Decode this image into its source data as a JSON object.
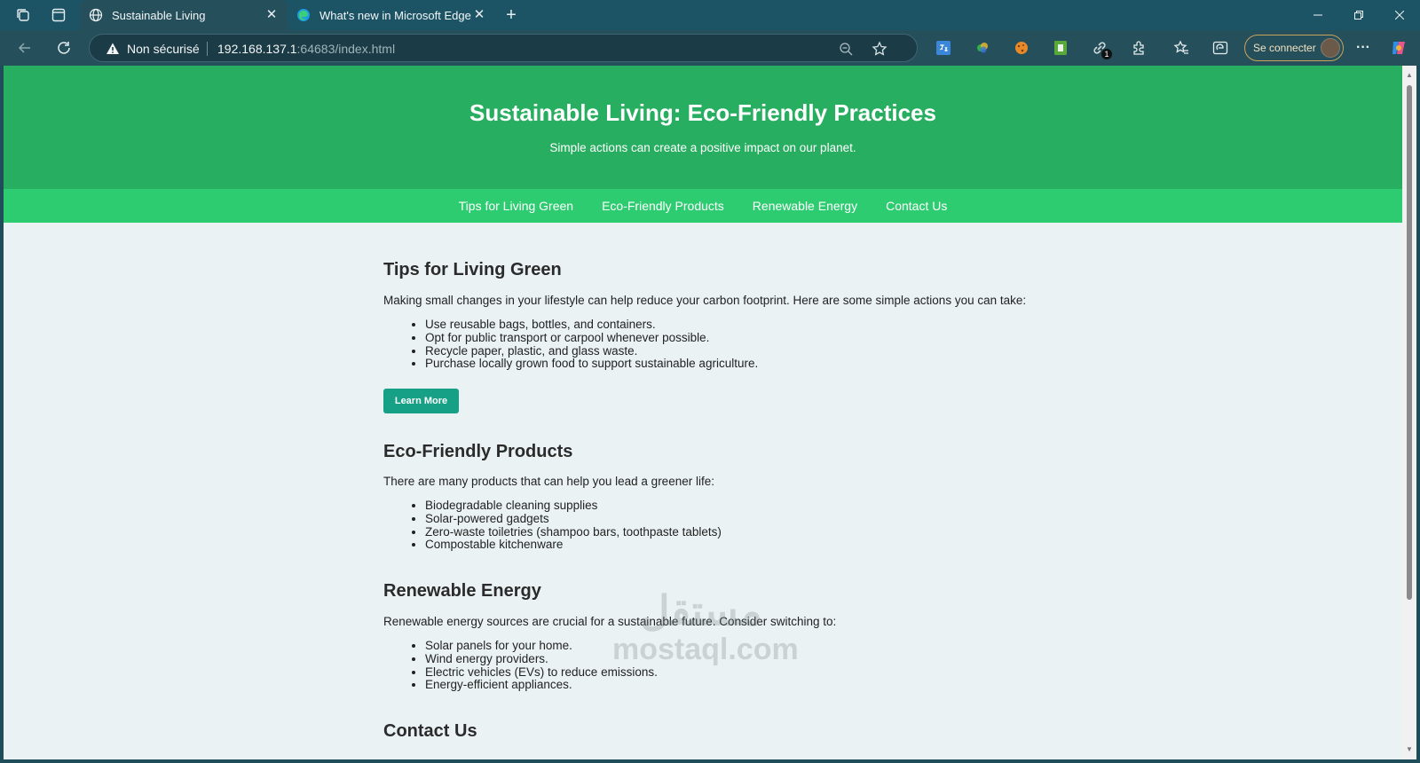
{
  "browser": {
    "tabs": [
      {
        "title": "Sustainable Living",
        "active": true
      },
      {
        "title": "What's new in Microsoft Edge",
        "active": false
      }
    ],
    "address": {
      "security": "Non sécurisé",
      "url_host": "192.168.137.1",
      "url_rest": ":64683/index.html"
    },
    "signin_label": "Se connecter",
    "extension_badge": "1"
  },
  "site": {
    "title": "Sustainable Living: Eco-Friendly Practices",
    "subtitle": "Simple actions can create a positive impact on our planet.",
    "nav": [
      "Tips for Living Green",
      "Eco-Friendly Products",
      "Renewable Energy",
      "Contact Us"
    ],
    "sections": {
      "tips": {
        "heading": "Tips for Living Green",
        "intro": "Making small changes in your lifestyle can help reduce your carbon footprint. Here are some simple actions you can take:",
        "items": [
          "Use reusable bags, bottles, and containers.",
          "Opt for public transport or carpool whenever possible.",
          "Recycle paper, plastic, and glass waste.",
          "Purchase locally grown food to support sustainable agriculture."
        ],
        "button": "Learn More"
      },
      "products": {
        "heading": "Eco-Friendly Products",
        "intro": "There are many products that can help you lead a greener life:",
        "items": [
          "Biodegradable cleaning supplies",
          "Solar-powered gadgets",
          "Zero-waste toiletries (shampoo bars, toothpaste tablets)",
          "Compostable kitchenware"
        ]
      },
      "energy": {
        "heading": "Renewable Energy",
        "intro": "Renewable energy sources are crucial for a sustainable future. Consider switching to:",
        "items": [
          "Solar panels for your home.",
          "Wind energy providers.",
          "Electric vehicles (EVs) to reduce emissions.",
          "Energy-efficient appliances."
        ]
      },
      "contact": {
        "heading": "Contact Us"
      }
    },
    "watermark": {
      "arabic": "مستقل",
      "latin": "mostaql.com"
    }
  },
  "colors": {
    "header": "#27ae60",
    "nav": "#2ecc71",
    "button": "#16a085",
    "page_bg": "#eaf2f3"
  }
}
